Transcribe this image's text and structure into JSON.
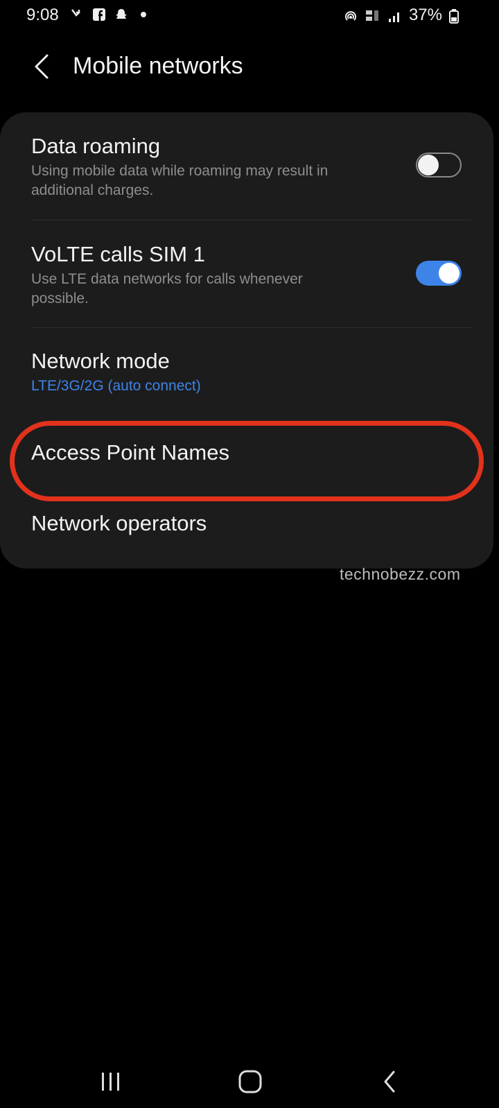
{
  "status_bar": {
    "time": "9:08",
    "battery_percent": "37%"
  },
  "header": {
    "title": "Mobile networks"
  },
  "settings": {
    "data_roaming": {
      "title": "Data roaming",
      "subtitle": "Using mobile data while roaming may result in additional charges.",
      "enabled": false
    },
    "volte": {
      "title": "VoLTE calls SIM 1",
      "subtitle": "Use LTE data networks for calls whenever possible.",
      "enabled": true
    },
    "network_mode": {
      "title": "Network mode",
      "value": "LTE/3G/2G (auto connect)"
    },
    "access_point_names": {
      "title": "Access Point Names"
    },
    "network_operators": {
      "title": "Network operators"
    }
  },
  "watermark": "technobezz.com",
  "colors": {
    "accent": "#3e84e8",
    "highlight": "#e2321c",
    "card_background": "#1c1c1c"
  }
}
